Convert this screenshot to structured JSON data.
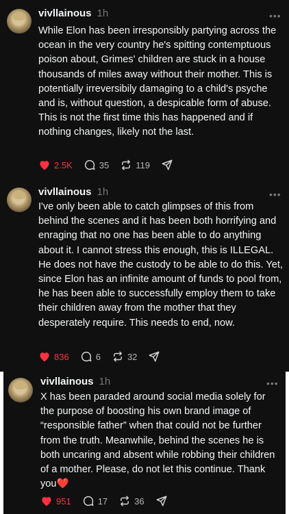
{
  "posts": [
    {
      "username": "vivllainous",
      "time": "1h",
      "more": "•••",
      "text": "While Elon has been irresponsibly partying across the ocean in the very country he's spitting contemptuous poison about, Grimes' children are stuck in a house thousands of miles away without their mother. This is potentially irreversibily damaging to a child's psyche and is, without question, a despicable form of abuse. This is not the first time this has happened and if nothing changes, likely not the last.",
      "likes": "2.5K",
      "replies": "35",
      "reposts": "119"
    },
    {
      "username": "vivllainous",
      "time": "1h",
      "more": "•••",
      "text": "I've only been able to catch glimpses of this from behind the scenes and it has been both horrifying and enraging that no one has been able to do anything about it. I cannot stress this enough, this is ILLEGAL. He does not have the custody to be able to do this. Yet, since Elon has an infinite amount of funds to pool from, he has been able to successfully employ them to take their children away from the mother that they desperately require. This needs to end, now.",
      "likes": "836",
      "replies": "6",
      "reposts": "32"
    },
    {
      "username": "vivllainous",
      "time": "1h",
      "more": "•••",
      "text": "X has been paraded around social media solely for the purpose of boosting his own brand image of “responsible father” when that could not be further from the truth. Meanwhile, behind the scenes he is both uncaring and absent while robbing their children of a mother. Please, do not let this continue. Thank you",
      "emoji": "❤️",
      "likes": "951",
      "replies": "17",
      "reposts": "36"
    }
  ],
  "colors": {
    "background": "#101010",
    "text": "#f3f5f7",
    "muted": "#777777",
    "like": "#ff3040"
  },
  "icons": [
    "heart-icon",
    "reply-icon",
    "repost-icon",
    "share-icon",
    "more-icon"
  ]
}
